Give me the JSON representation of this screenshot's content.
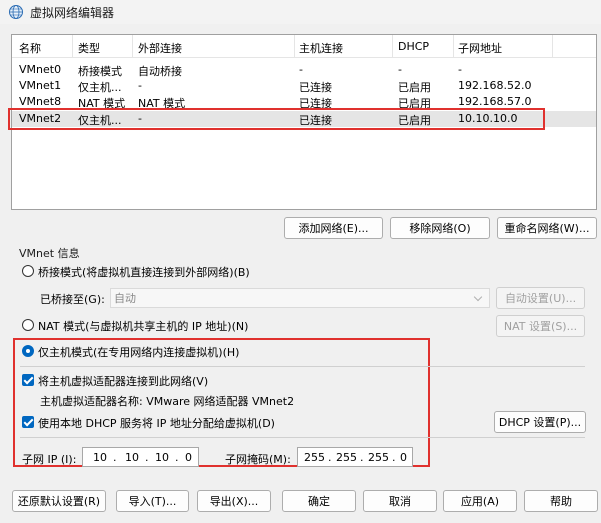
{
  "window": {
    "title": "虚拟网络编辑器",
    "icon": "globe-icon"
  },
  "network_table": {
    "columns": [
      "名称",
      "类型",
      "外部连接",
      "主机连接",
      "DHCP",
      "子网地址"
    ],
    "rows": [
      {
        "name": "VMnet0",
        "type": "桥接模式",
        "external": "自动桥接",
        "host": "-",
        "dhcp": "-",
        "subnet": "-"
      },
      {
        "name": "VMnet1",
        "type": "仅主机...",
        "external": "-",
        "host": "已连接",
        "dhcp": "已启用",
        "subnet": "192.168.52.0"
      },
      {
        "name": "VMnet8",
        "type": "NAT 模式",
        "external": "NAT 模式",
        "host": "已连接",
        "dhcp": "已启用",
        "subnet": "192.168.57.0"
      },
      {
        "name": "VMnet2",
        "type": "仅主机...",
        "external": "-",
        "host": "已连接",
        "dhcp": "已启用",
        "subnet": "10.10.10.0"
      }
    ],
    "selected_index": 3
  },
  "list_buttons": {
    "add": "添加网络(E)...",
    "remove": "移除网络(O)",
    "rename": "重命名网络(W)..."
  },
  "vmnet_info": {
    "group_label": "VMnet 信息",
    "bridged_label": "桥接模式(将虚拟机直接连接到外部网络)(B)",
    "bridged_to_label": "已桥接至(G):",
    "bridged_to_value": "自动",
    "auto_settings_label": "自动设置(U)...",
    "nat_label": "NAT 模式(与虚拟机共享主机的 IP 地址)(N)",
    "nat_settings_label": "NAT 设置(S)...",
    "hostonly_label": "仅主机模式(在专用网络内连接虚拟机)(H)",
    "selected_mode": "hostonly",
    "connect_adapter_label": "将主机虚拟适配器连接到此网络(V)",
    "connect_adapter_checked": true,
    "adapter_name_label": "主机虚拟适配器名称: VMware 网络适配器 VMnet2",
    "dhcp_label": "使用本地 DHCP 服务将 IP 地址分配给虚拟机(D)",
    "dhcp_checked": true,
    "dhcp_settings_label": "DHCP 设置(P)...",
    "subnet_ip_label": "子网 IP (I):",
    "subnet_ip": [
      "10",
      "10",
      "10",
      "0"
    ],
    "subnet_mask_label": "子网掩码(M):",
    "subnet_mask": [
      "255",
      "255",
      "255",
      "0"
    ]
  },
  "footer_buttons": {
    "restore_defaults": "还原默认设置(R)",
    "import": "导入(T)...",
    "export": "导出(X)...",
    "ok": "确定",
    "cancel": "取消",
    "apply": "应用(A)",
    "help": "帮助"
  },
  "colors": {
    "highlight_box": "#e0312e",
    "accent": "#0067c0",
    "selected_row": "#e5e5e5"
  }
}
